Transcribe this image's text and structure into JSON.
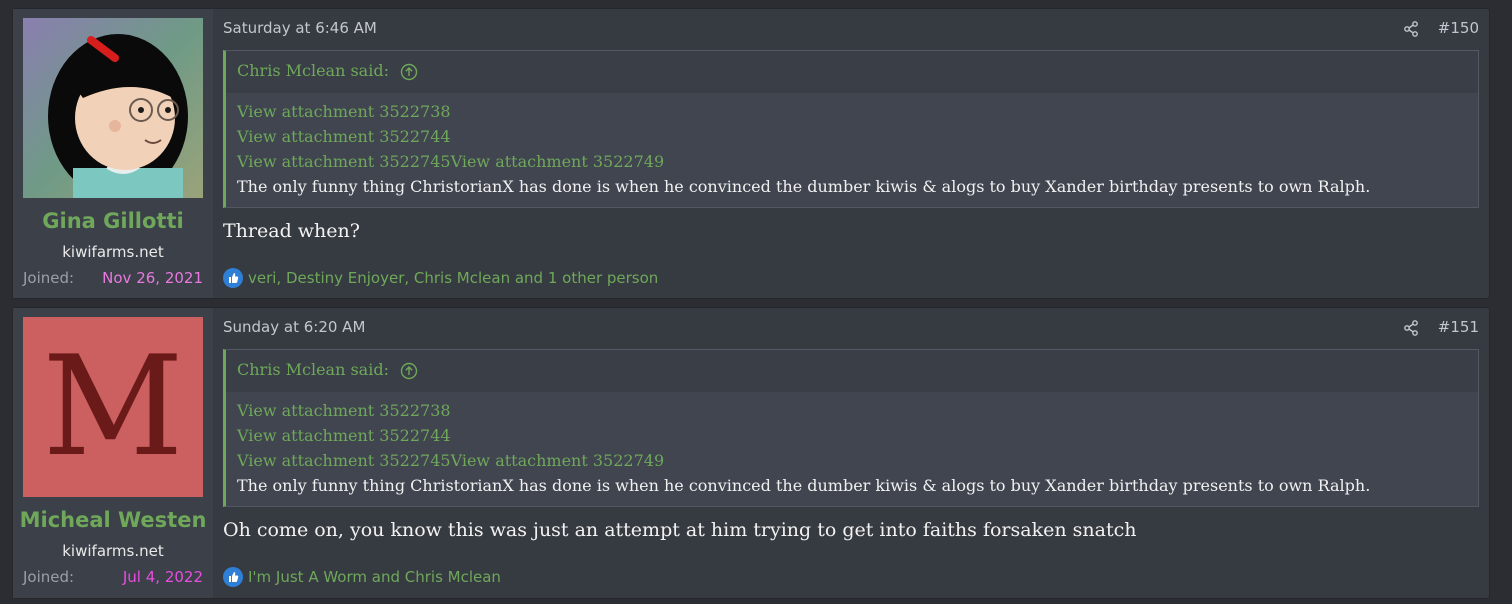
{
  "posts": [
    {
      "username": "Gina Gillotti",
      "user_title": "kiwifarms.net",
      "joined_label": "Joined:",
      "joined_date": "Nov 26, 2021",
      "joined_color": "#e879e0",
      "avatar_icon": "cartoon-girl-avatar",
      "date": "Saturday at 6:46 AM",
      "post_number": "#150",
      "quote": {
        "author": "Chris Mclean said:",
        "attachments": [
          "View attachment 3522738",
          "View attachment 3522744",
          "View attachment 3522745View attachment 3522749"
        ],
        "text": "The only funny thing ChristorianX has done is when he convinced the dumber kiwis & alogs to buy Xander birthday presents to own Ralph."
      },
      "message": "Thread when?",
      "reactions": "veri, Destiny Enjoyer, Chris Mclean and 1 other person"
    },
    {
      "username": "Micheal Westen",
      "user_title": "kiwifarms.net",
      "joined_label": "Joined:",
      "joined_date": "Jul 4, 2022",
      "joined_color": "#e84ee0",
      "avatar_letter": "M",
      "date": "Sunday at 6:20 AM",
      "post_number": "#151",
      "quote": {
        "author": "Chris Mclean said:",
        "attachments": [
          "View attachment 3522738",
          "View attachment 3522744",
          "View attachment 3522745View attachment 3522749"
        ],
        "text": "The only funny thing ChristorianX has done is when he convinced the dumber kiwis & alogs to buy Xander birthday presents to own Ralph."
      },
      "message": "Oh come on, you know this was just an attempt at him trying to get into faiths forsaken snatch",
      "reactions": "I'm Just A Worm and Chris Mclean"
    }
  ],
  "colors": {
    "accent": "#6fa85a",
    "like_blue": "#2f7fd6"
  }
}
